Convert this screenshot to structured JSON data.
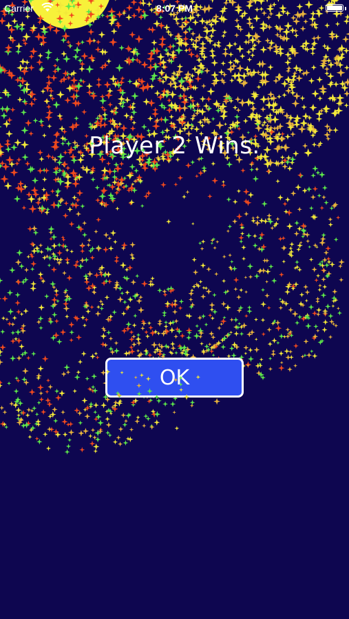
{
  "status_bar": {
    "carrier": "Carrier",
    "time": "8:07 PM",
    "wifi_icon": "wifi-icon",
    "battery_icon": "battery-icon"
  },
  "game": {
    "result_message": "Player 2 Wins.",
    "ok_button_label": "OK",
    "background_color": "#0e0650",
    "button_color": "#2f4ff0",
    "sun_color": "#f7f13a",
    "sparkle_colors": [
      "#f2e83a",
      "#f04a1e",
      "#5ee84a",
      "#e8b43c"
    ]
  }
}
